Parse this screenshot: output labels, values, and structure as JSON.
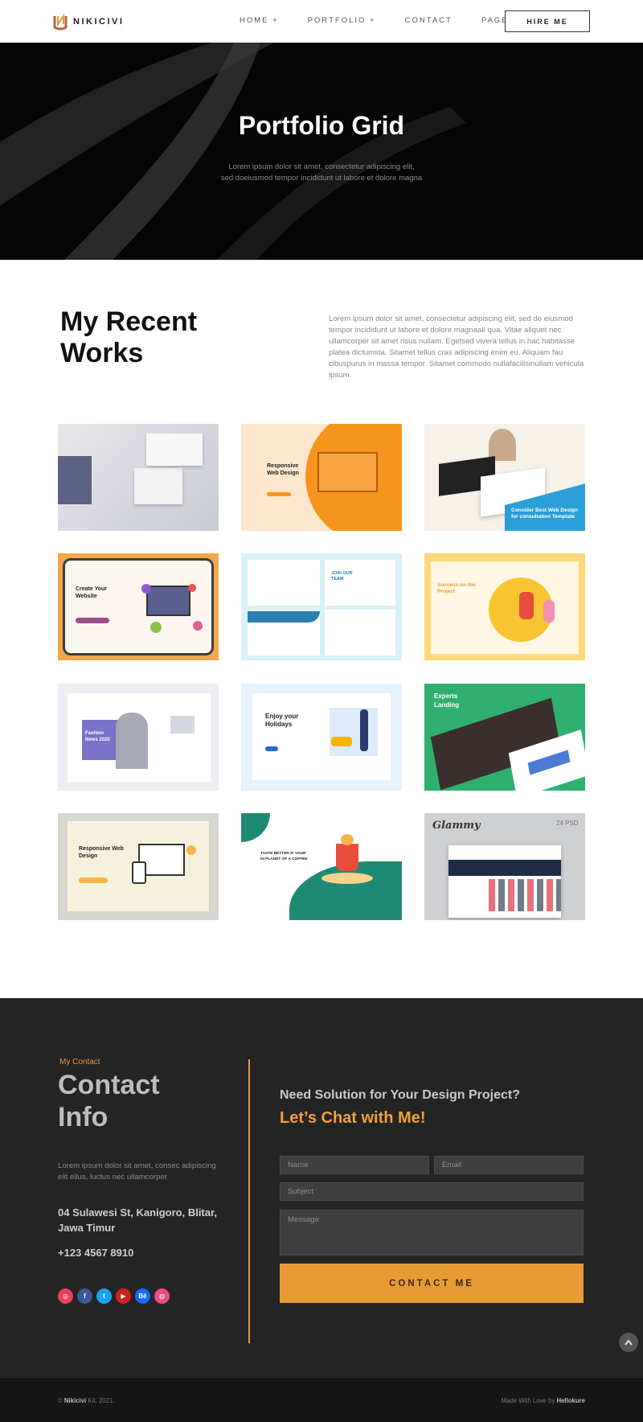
{
  "brand": {
    "name": "NIKICIVI",
    "accent": "#e89a35"
  },
  "nav": {
    "items": [
      "HOME +",
      "PORTFOLIO +",
      "CONTACT",
      "PAGES +"
    ],
    "cta": "HIRE ME"
  },
  "hero": {
    "title": "Portfolio Grid",
    "subtitle_line1": "Lorem ipsum dolor sit amet, consectetur adipiscing elit,",
    "subtitle_line2": "sed doeiusmod tempor incididunt ut labore et dolore magna"
  },
  "works": {
    "title_line1": "My Recent",
    "title_line2": "Works",
    "description": "Lorem ipsum dolor sit amet, consectetur adipiscing elit, sed do eiusmod tempor incididunt ut labore et dolore magnaali qua. Vitae aliquet nec ullamcorper sit amet risus nullam. Egetsed vivera tellus in hac habitasse platea dictumsta. Sitamet tellus cras adipiscing enim eu. Aliquam fau cibuspurus in massa tempor. Sitamet commodo nullafacilisinullam vehicula ipsum.",
    "cards": [
      {
        "id": "card-1",
        "caption": ""
      },
      {
        "id": "card-2",
        "caption": "Responsive Web Design"
      },
      {
        "id": "card-3",
        "caption": "Consider Best Web Design for consultation Template"
      },
      {
        "id": "card-4",
        "caption": "Create Your Website"
      },
      {
        "id": "card-5",
        "caption": "JOIN OUR TEAM"
      },
      {
        "id": "card-6",
        "caption": "Success on the Project"
      },
      {
        "id": "card-7",
        "caption": "Fashion News 2020"
      },
      {
        "id": "card-8",
        "caption": "Enjoy your Holidays"
      },
      {
        "id": "card-9",
        "caption": "Experts Landing"
      },
      {
        "id": "card-10",
        "caption": "Responsive Web Design"
      },
      {
        "id": "card-11",
        "caption": "TASTE BETTER IF YOUR IN PLANET OF A COFFEE"
      },
      {
        "id": "card-12",
        "caption": "Glammy"
      }
    ],
    "card12_badge": "24 PSD"
  },
  "contact": {
    "kicker": "My Contact",
    "title_line1": "Contact",
    "title_line2": "Info",
    "description": "Lorem ipsum dolor sit amet, consec adipiscing elit ellus, luctus nec ullamcorper",
    "address": "04 Sulawesi St, Kanigoro, Blitar, Jawa Timur",
    "phone": "+123 4567 8910",
    "heading": "Need Solution for Your Design Project?",
    "subheading": "Let’s Chat with Me!",
    "form": {
      "name_placeholder": "Name",
      "email_placeholder": "Email",
      "subject_placeholder": "Subject",
      "message_placeholder": "Message",
      "submit_label": "CONTACT ME"
    },
    "socials": [
      {
        "name": "instagram-icon",
        "color": "#e4405f",
        "glyph": "◎"
      },
      {
        "name": "facebook-icon",
        "color": "#3b5998",
        "glyph": "f"
      },
      {
        "name": "twitter-icon",
        "color": "#1da1f2",
        "glyph": "t"
      },
      {
        "name": "youtube-icon",
        "color": "#cd201f",
        "glyph": "▶"
      },
      {
        "name": "behance-icon",
        "color": "#1769ff",
        "glyph": "Bē"
      },
      {
        "name": "dribbble-icon",
        "color": "#ea4c89",
        "glyph": "◍"
      }
    ]
  },
  "footer": {
    "left_prefix": "© ",
    "left_brand": "Nikicivi",
    "left_suffix": " Kit. 2021.",
    "right_prefix": "Made With Love by ",
    "right_brand": "Hellokure"
  }
}
